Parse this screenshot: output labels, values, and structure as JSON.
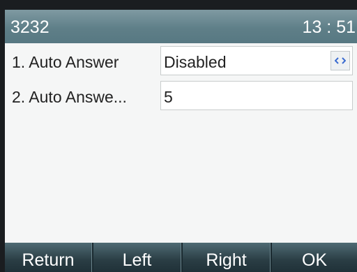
{
  "titlebar": {
    "account": "3232",
    "time": "13 : 51"
  },
  "settings": [
    {
      "label": "1. Auto Answer",
      "value": "Disabled",
      "switch_icon": "left-right-arrows-icon"
    },
    {
      "label": "2. Auto Answe...",
      "value": "5"
    }
  ],
  "softkeys": [
    "Return",
    "Left",
    "Right",
    "OK"
  ],
  "colors": {
    "titlebar": "#5f7f88",
    "softkey_bar": "#2a3d44",
    "screen_bg": "#f5f6f6",
    "switch_arrow": "#3a6bd0"
  }
}
